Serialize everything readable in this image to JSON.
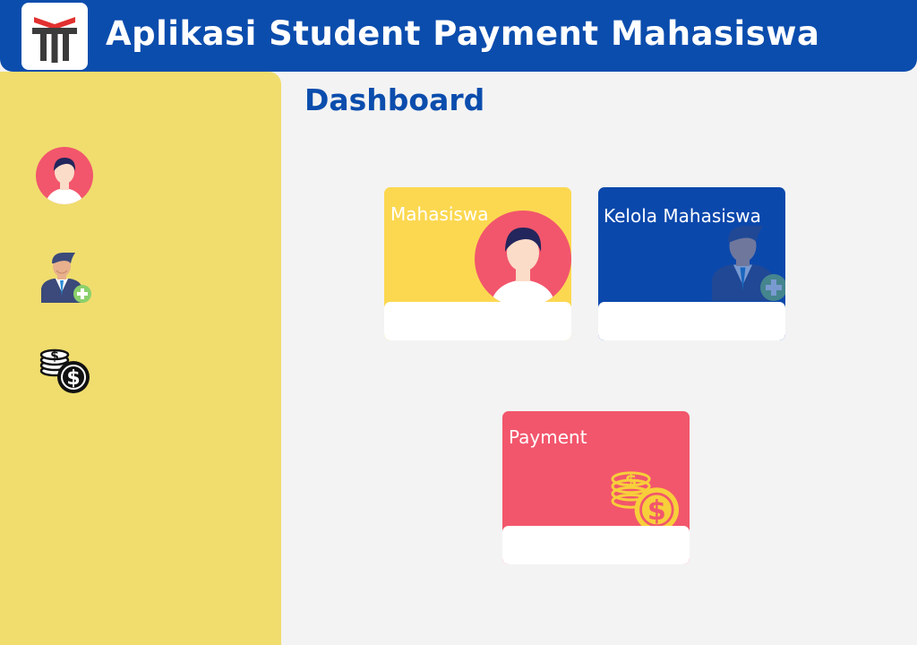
{
  "header": {
    "title": "Aplikasi Student Payment Mahasiswa",
    "logo_icon": "tut-wuri-logo-icon",
    "bg_color": "#0b4dad"
  },
  "sidebar": {
    "bg_color": "#f0dd6e",
    "items": [
      {
        "icon": "student-avatar-icon"
      },
      {
        "icon": "add-student-icon"
      },
      {
        "icon": "coins-icon"
      }
    ]
  },
  "main": {
    "title": "Dashboard",
    "cards": [
      {
        "label": "Mahasiswa",
        "color": "#fcd851",
        "icon": "student-avatar-icon"
      },
      {
        "label": "Kelola Mahasiswa",
        "color": "#0b48ac",
        "icon": "add-student-icon"
      },
      {
        "label": "Payment",
        "color": "#f2566c",
        "icon": "coins-icon"
      }
    ]
  }
}
